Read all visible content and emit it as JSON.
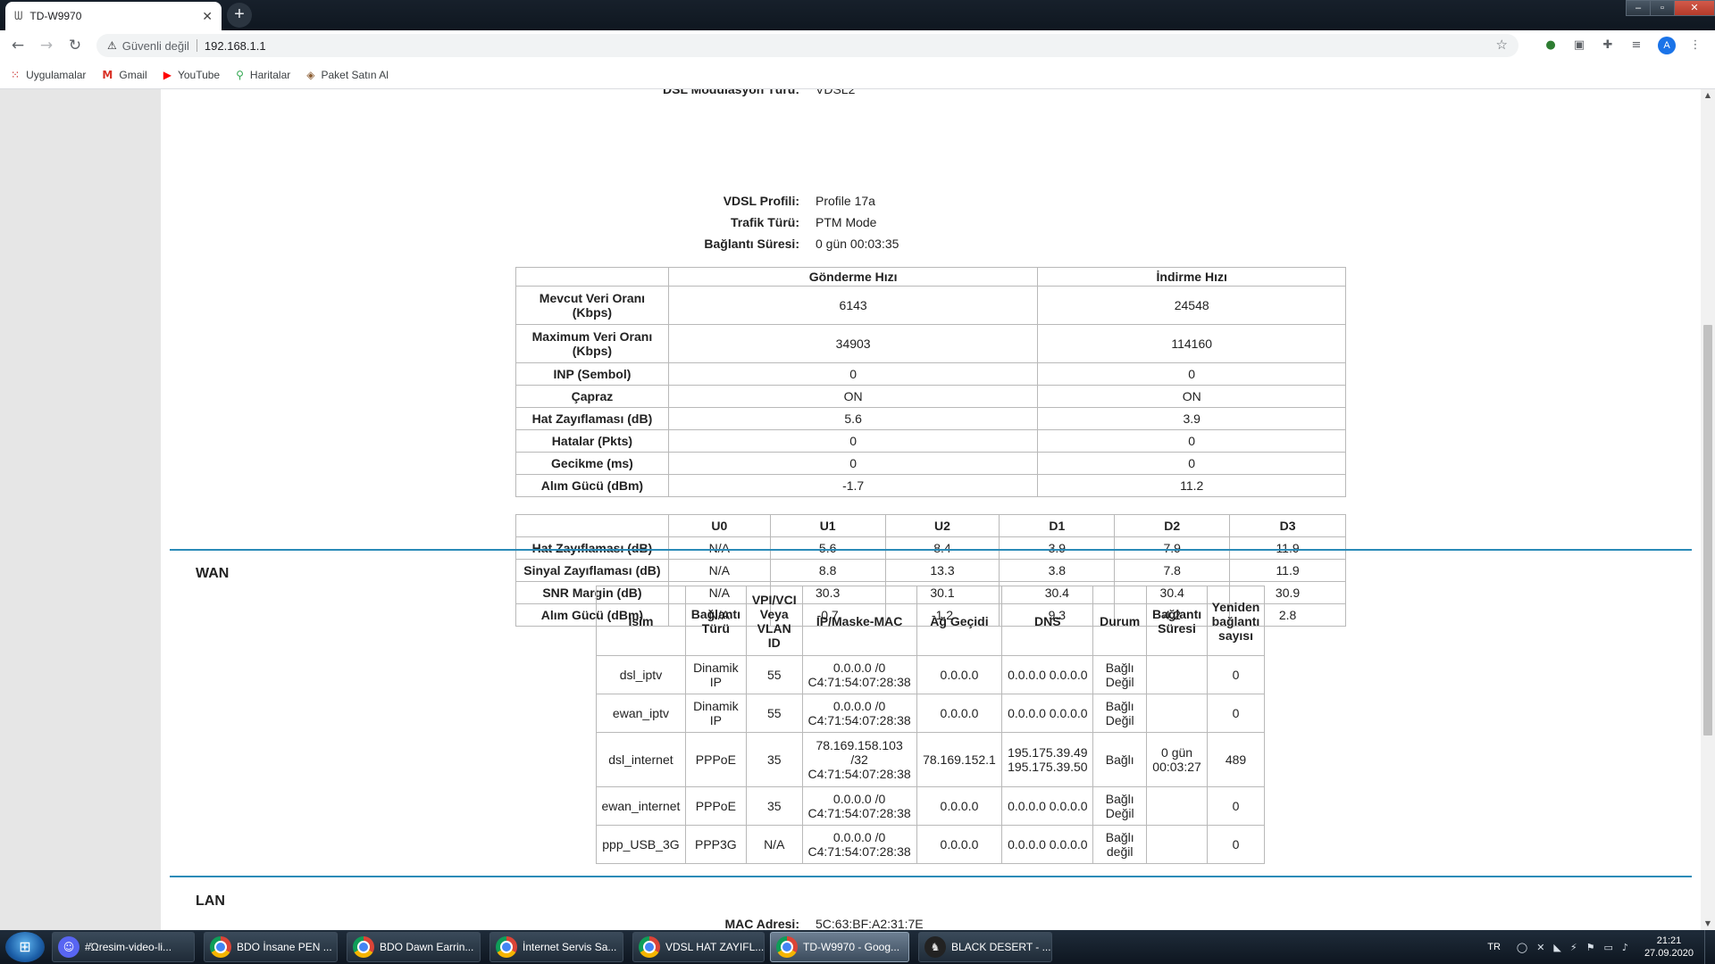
{
  "browser": {
    "tab_title": "TD-W9970",
    "tab_favicon": "router-icon",
    "security_label": "Güvenli değil",
    "url": "192.168.1.1",
    "bookmarks": [
      "Uygulamalar",
      "Gmail",
      "YouTube",
      "Haritalar",
      "Paket Satın Al"
    ],
    "avatar_letter": "A"
  },
  "dsl_info": {
    "partial_label": "DSL Modülasyon Türü:",
    "partial_value": "VDSL2",
    "rows": [
      {
        "label": "VDSL Profili:",
        "value": "Profile 17a"
      },
      {
        "label": "Trafik Türü:",
        "value": "PTM Mode"
      },
      {
        "label": "Bağlantı Süresi:",
        "value": "0 gün 00:03:35"
      }
    ]
  },
  "rate_table": {
    "headers": [
      "",
      "Gönderme Hızı",
      "İndirme Hızı"
    ],
    "rows": [
      [
        "Mevcut Veri Oranı (Kbps)",
        "6143",
        "24548"
      ],
      [
        "Maximum Veri Oranı (Kbps)",
        "34903",
        "114160"
      ],
      [
        "INP (Sembol)",
        "0",
        "0"
      ],
      [
        "Çapraz",
        "ON",
        "ON"
      ],
      [
        "Hat Zayıflaması (dB)",
        "5.6",
        "3.9"
      ],
      [
        "Hatalar (Pkts)",
        "0",
        "0"
      ],
      [
        "Gecikme (ms)",
        "0",
        "0"
      ],
      [
        "Alım Gücü (dBm)",
        "-1.7",
        "11.2"
      ]
    ]
  },
  "band_table": {
    "headers": [
      "",
      "U0",
      "U1",
      "U2",
      "D1",
      "D2",
      "D3"
    ],
    "rows": [
      [
        "Hat Zayıflaması (dB)",
        "N/A",
        "5.6",
        "8.4",
        "3.9",
        "7.9",
        "11.9"
      ],
      [
        "Sinyal Zayıflaması (dB)",
        "N/A",
        "8.8",
        "13.3",
        "3.8",
        "7.8",
        "11.9"
      ],
      [
        "SNR Margin (dB)",
        "N/A",
        "30.3",
        "30.1",
        "30.4",
        "30.4",
        "30.9"
      ],
      [
        "Alım Gücü (dBm)",
        "N/A",
        "-0.7",
        "-1.2",
        "9.3",
        "4.2",
        "2.8"
      ]
    ]
  },
  "wan": {
    "title": "WAN",
    "headers": [
      "İsim",
      "Bağlantı Türü",
      "VPI/VCI Veya VLAN ID",
      "IP/Maske-MAC",
      "Ağ Geçidi",
      "DNS",
      "Durum",
      "Bağlantı Süresi",
      "Yeniden bağlantı sayısı"
    ],
    "rows": [
      [
        "dsl_iptv",
        "Dinamik IP",
        "55",
        "0.0.0.0 /0 C4:71:54:07:28:38",
        "0.0.0.0",
        "0.0.0.0 0.0.0.0",
        "Bağlı Değil",
        "",
        "0"
      ],
      [
        "ewan_iptv",
        "Dinamik IP",
        "55",
        "0.0.0.0 /0 C4:71:54:07:28:38",
        "0.0.0.0",
        "0.0.0.0 0.0.0.0",
        "Bağlı Değil",
        "",
        "0"
      ],
      [
        "dsl_internet",
        "PPPoE",
        "35",
        "78.169.158.103 /32 C4:71:54:07:28:38",
        "78.169.152.1",
        "195.175.39.49 195.175.39.50",
        "Bağlı",
        "0 gün 00:03:27",
        "489"
      ],
      [
        "ewan_internet",
        "PPPoE",
        "35",
        "0.0.0.0 /0 C4:71:54:07:28:38",
        "0.0.0.0",
        "0.0.0.0 0.0.0.0",
        "Bağlı Değil",
        "",
        "0"
      ],
      [
        "ppp_USB_3G",
        "PPP3G",
        "N/A",
        "0.0.0.0 /0 C4:71:54:07:28:38",
        "0.0.0.0",
        "0.0.0.0 0.0.0.0",
        "Bağlı değil",
        "",
        "0"
      ]
    ]
  },
  "lan": {
    "title": "LAN",
    "mac_label": "MAC Adresi:",
    "mac_value": "5C:63:BF:A2:31:7E"
  },
  "taskbar": {
    "items": [
      {
        "label": "#Ώresim-video-li...",
        "icon": "discord-icon"
      },
      {
        "label": "BDO İnsane PEN ...",
        "icon": "chrome-icon"
      },
      {
        "label": "BDO Dawn Earrin...",
        "icon": "chrome-icon"
      },
      {
        "label": "İnternet Servis Sa...",
        "icon": "chrome-icon"
      },
      {
        "label": "VDSL HAT ZAYIFL...",
        "icon": "chrome-icon"
      },
      {
        "label": "TD-W9970 - Goog...",
        "icon": "chrome-icon"
      },
      {
        "label": "BLACK DESERT - ...",
        "icon": "game-icon"
      }
    ],
    "language": "TR",
    "time": "21:21",
    "date": "27.09.2020"
  }
}
